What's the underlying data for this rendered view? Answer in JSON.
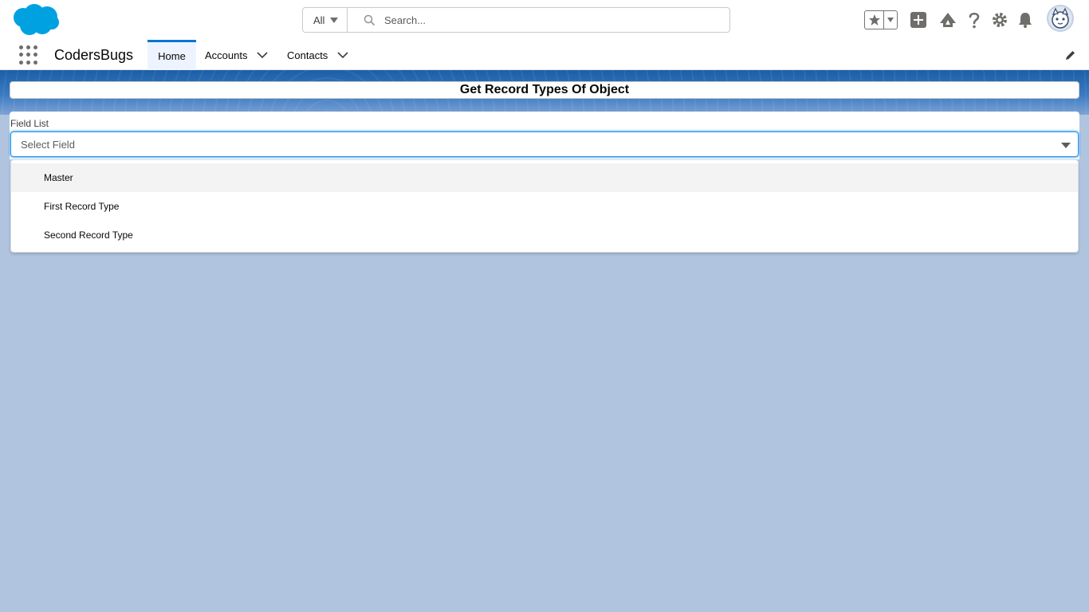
{
  "header": {
    "logo": "salesforce-cloud-logo",
    "search": {
      "scope": "All",
      "placeholder": "Search..."
    },
    "tools": [
      "favorites-star-icon",
      "add-icon",
      "trailhead-icon",
      "help-icon",
      "setup-gear-icon",
      "notifications-bell-icon",
      "user-avatar"
    ]
  },
  "nav": {
    "app_name": "CodersBugs",
    "tabs": [
      {
        "label": "Home",
        "active": true
      },
      {
        "label": "Accounts",
        "has_menu": true
      },
      {
        "label": "Contacts",
        "has_menu": true
      }
    ]
  },
  "main": {
    "title": "Get Record Types Of Object",
    "field": {
      "label": "Field List",
      "placeholder": "Select Field"
    },
    "options": [
      "Master",
      "First Record Type",
      "Second Record Type"
    ]
  },
  "colors": {
    "brand": "#00a1e0",
    "accent": "#0176d3",
    "page_bg": "#b0c4df"
  }
}
